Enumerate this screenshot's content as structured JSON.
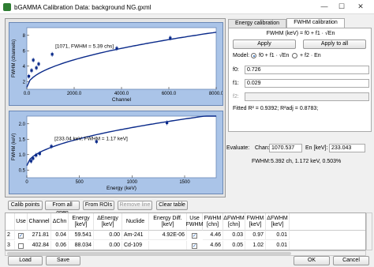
{
  "window": {
    "title": "bGAMMA Calibration Data: background NG.gxml",
    "minimize": "—",
    "maximize": "☐",
    "close": "✕"
  },
  "plot_top": {
    "annotation": "[1071, FWHM = 5.39 chs]",
    "ylabel": "FWHM (channels)",
    "xlabel": "Channel",
    "yticks": [
      "8",
      "6",
      "4",
      "2"
    ],
    "xticks": [
      "0.0",
      "2000.0",
      "4000.0",
      "6000.0",
      "8000.0"
    ],
    "points": [
      [
        85,
        2.0
      ],
      [
        200,
        2.9
      ],
      [
        272,
        4.5
      ],
      [
        403,
        3.3
      ],
      [
        500,
        3.9
      ],
      [
        1071,
        5.39
      ],
      [
        3800,
        6.3
      ],
      [
        6060,
        7.9
      ]
    ],
    "curve_color": "#0a2a8a"
  },
  "plot_bottom": {
    "annotation": "[233.04 keV, FWHM = 1.17 keV]",
    "ylabel": "FWHM (keV)",
    "xlabel": "Energy (keV)",
    "yticks": [
      "2.0",
      "1.5",
      "1.0",
      "0.5"
    ],
    "xticks": [
      "0",
      "500",
      "1000",
      "1500"
    ],
    "points": [
      [
        40,
        0.62
      ],
      [
        59,
        0.72
      ],
      [
        88,
        0.84
      ],
      [
        122,
        0.9
      ],
      [
        233,
        1.17
      ],
      [
        662,
        1.35
      ],
      [
        1332,
        2.05
      ]
    ]
  },
  "tabs": {
    "energy": "Energy calibration",
    "fwhm": "FWHM calibration"
  },
  "fwhm_panel": {
    "formula": "FWHM (keV) = f0 + f1 · √En",
    "apply": "Apply",
    "apply_all": "Apply to all",
    "model_label": "Model:",
    "model_opt1": "f0 + f1 · √En",
    "model_opt2": "+ f2 · En",
    "f0_label": "f0:",
    "f0_value": "0.726",
    "f1_label": "f1:",
    "f1_value": "0.029",
    "f2_label": "f2:",
    "f2_value": "",
    "fitted": "Fitted R² = 0.9392; R²adj = 0.8783;"
  },
  "evaluate": {
    "label": "Evaluate:",
    "chan_label": "Chan:",
    "chan_value": "1070.537",
    "en_label": "En [keV]:",
    "en_value": "233.043",
    "fwhm_label": "FWHM:",
    "fwhm_value": "5.392 ch, 1.172 keV, 0.503%"
  },
  "toolbar": {
    "calib_points": "Calib points",
    "from_all_open": "From all open",
    "from_rois": "From ROIs",
    "remove_line": "Remove line",
    "clear_table": "Clear table"
  },
  "table": {
    "headers": [
      "Use",
      "Channel",
      "ΔChn",
      "Energy [keV]",
      "ΔEnergy [keV]",
      "Nuclide",
      "Energy Diff. [keV]",
      "Use FWHM",
      "FWHM [chn]",
      "ΔFWHM [chn]",
      "FWHM [keV]",
      "ΔFWHM [keV]"
    ],
    "rows": [
      {
        "num": "2",
        "use": "✓",
        "channel": "271.81",
        "dchn": "0.04",
        "energy": "59.541",
        "denergy": "0.00",
        "nuclide": "Am-241",
        "ediff": "4.92E-06",
        "usefwhm": "✓",
        "fwhm_chn": "4.46",
        "dfwhm_chn": "0.03",
        "fwhm_kev": "0.97",
        "dfwhm_kev": "0.01"
      },
      {
        "num": "3",
        "use": "",
        "channel": "402.84",
        "dchn": "0.06",
        "energy": "88.034",
        "denergy": "0.00",
        "nuclide": "Cd-109",
        "ediff": "",
        "usefwhm": "✓",
        "fwhm_chn": "4.66",
        "dfwhm_chn": "0.05",
        "fwhm_kev": "1.02",
        "dfwhm_kev": "0.01"
      }
    ]
  },
  "footer": {
    "load": "Load",
    "save": "Save",
    "ok": "OK",
    "cancel": "Cancel"
  }
}
